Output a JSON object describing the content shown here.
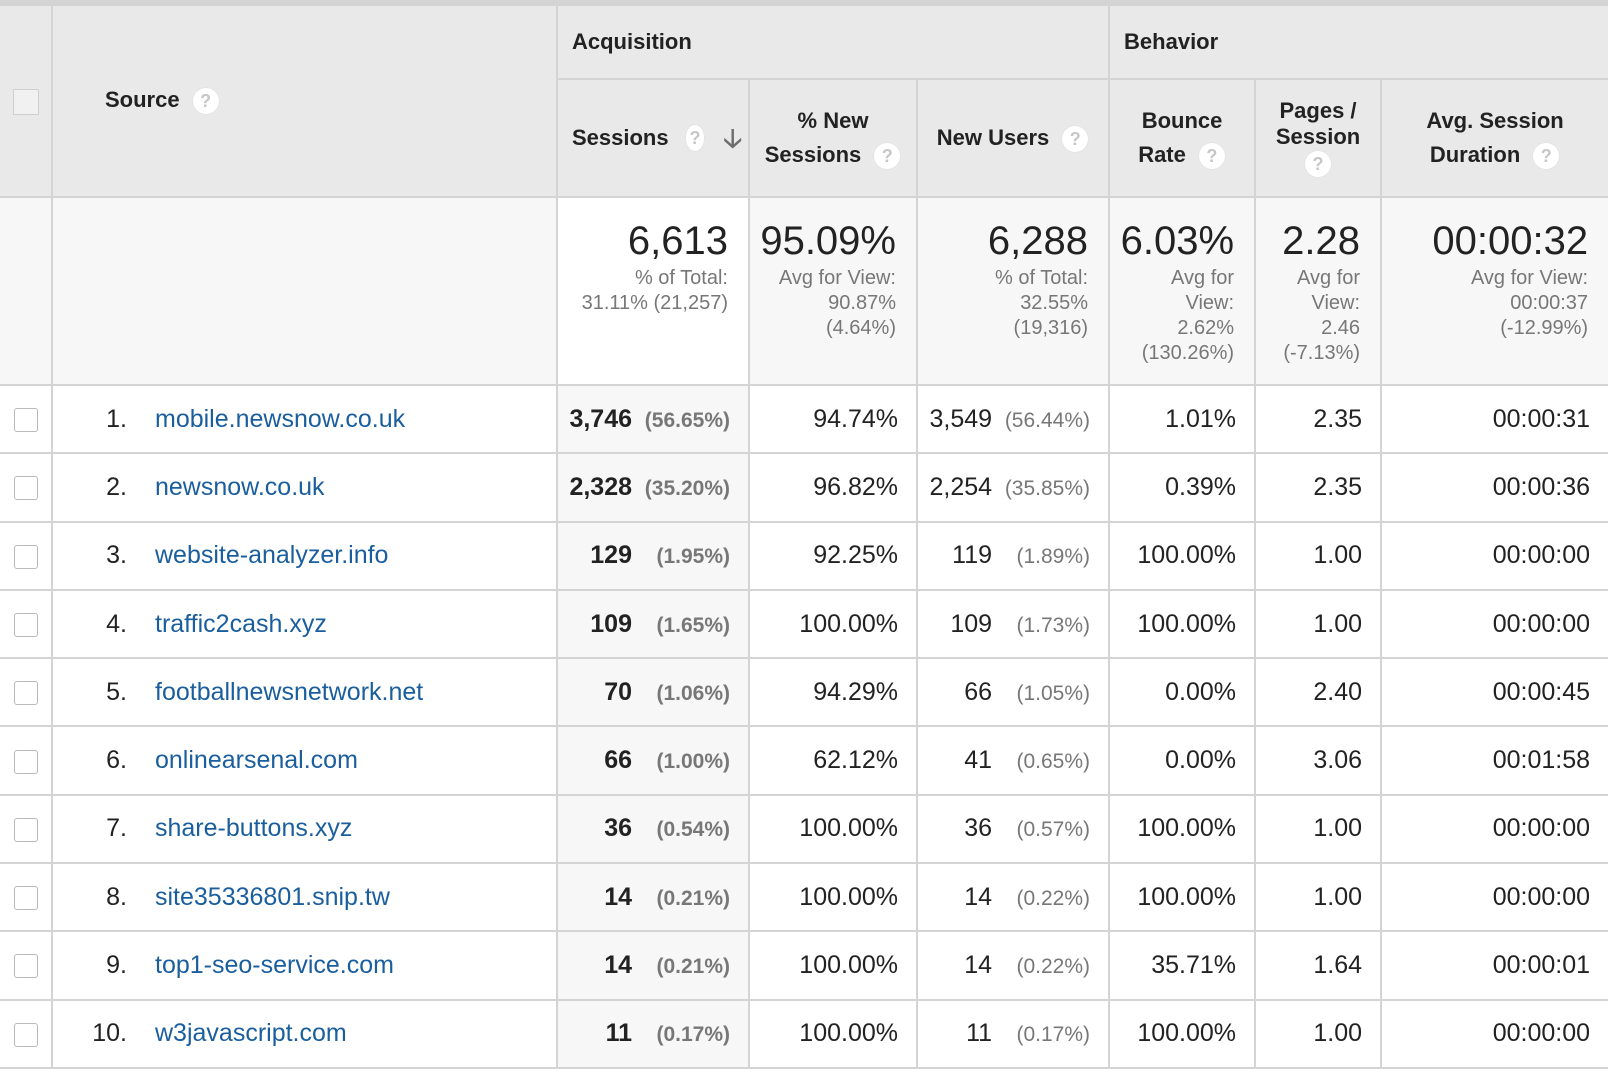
{
  "header": {
    "source_label": "Source",
    "groups": {
      "acquisition": "Acquisition",
      "behavior": "Behavior"
    },
    "sessions_label": "Sessions",
    "new_sessions_line1": "% New",
    "new_sessions_line2": "Sessions",
    "new_users_label": "New Users",
    "bounce_line1": "Bounce",
    "bounce_line2": "Rate",
    "pages_line1": "Pages /",
    "pages_line2": "Session",
    "duration_line1": "Avg. Session",
    "duration_line2": "Duration",
    "sort_icon": "arrow-down-icon",
    "help_icon": "question-mark-icon"
  },
  "totals": {
    "sessions": {
      "value": "6,613",
      "line1": "% of Total:",
      "line2": "31.11% (21,257)"
    },
    "new_sessions": {
      "value": "95.09%",
      "line1": "Avg for View:",
      "line2": "90.87%",
      "line3": "(4.64%)"
    },
    "new_users": {
      "value": "6,288",
      "line1": "% of Total:",
      "line2": "32.55%",
      "line3": "(19,316)"
    },
    "bounce_rate": {
      "value": "6.03%",
      "line1": "Avg for",
      "line2": "View:",
      "line3": "2.62%",
      "line4": "(130.26%)"
    },
    "pages_session": {
      "value": "2.28",
      "line1": "Avg for",
      "line2": "View:",
      "line3": "2.46",
      "line4": "(-7.13%)"
    },
    "duration": {
      "value": "00:00:32",
      "line1": "Avg for View:",
      "line2": "00:00:37",
      "line3": "(-12.99%)"
    }
  },
  "rows": [
    {
      "index": "1.",
      "source": "mobile.newsnow.co.uk",
      "sessions": "3,746",
      "sessions_pct": "(56.65%)",
      "new_sessions": "94.74%",
      "new_users": "3,549",
      "new_users_pct": "(56.44%)",
      "bounce_rate": "1.01%",
      "pages_session": "2.35",
      "duration": "00:00:31"
    },
    {
      "index": "2.",
      "source": "newsnow.co.uk",
      "sessions": "2,328",
      "sessions_pct": "(35.20%)",
      "new_sessions": "96.82%",
      "new_users": "2,254",
      "new_users_pct": "(35.85%)",
      "bounce_rate": "0.39%",
      "pages_session": "2.35",
      "duration": "00:00:36"
    },
    {
      "index": "3.",
      "source": "website-analyzer.info",
      "sessions": "129",
      "sessions_pct": "(1.95%)",
      "new_sessions": "92.25%",
      "new_users": "119",
      "new_users_pct": "(1.89%)",
      "bounce_rate": "100.00%",
      "pages_session": "1.00",
      "duration": "00:00:00"
    },
    {
      "index": "4.",
      "source": "traffic2cash.xyz",
      "sessions": "109",
      "sessions_pct": "(1.65%)",
      "new_sessions": "100.00%",
      "new_users": "109",
      "new_users_pct": "(1.73%)",
      "bounce_rate": "100.00%",
      "pages_session": "1.00",
      "duration": "00:00:00"
    },
    {
      "index": "5.",
      "source": "footballnewsnetwork.net",
      "sessions": "70",
      "sessions_pct": "(1.06%)",
      "new_sessions": "94.29%",
      "new_users": "66",
      "new_users_pct": "(1.05%)",
      "bounce_rate": "0.00%",
      "pages_session": "2.40",
      "duration": "00:00:45"
    },
    {
      "index": "6.",
      "source": "onlinearsenal.com",
      "sessions": "66",
      "sessions_pct": "(1.00%)",
      "new_sessions": "62.12%",
      "new_users": "41",
      "new_users_pct": "(0.65%)",
      "bounce_rate": "0.00%",
      "pages_session": "3.06",
      "duration": "00:01:58"
    },
    {
      "index": "7.",
      "source": "share-buttons.xyz",
      "sessions": "36",
      "sessions_pct": "(0.54%)",
      "new_sessions": "100.00%",
      "new_users": "36",
      "new_users_pct": "(0.57%)",
      "bounce_rate": "100.00%",
      "pages_session": "1.00",
      "duration": "00:00:00"
    },
    {
      "index": "8.",
      "source": "site35336801.snip.tw",
      "sessions": "14",
      "sessions_pct": "(0.21%)",
      "new_sessions": "100.00%",
      "new_users": "14",
      "new_users_pct": "(0.22%)",
      "bounce_rate": "100.00%",
      "pages_session": "1.00",
      "duration": "00:00:00"
    },
    {
      "index": "9.",
      "source": "top1-seo-service.com",
      "sessions": "14",
      "sessions_pct": "(0.21%)",
      "new_sessions": "100.00%",
      "new_users": "14",
      "new_users_pct": "(0.22%)",
      "bounce_rate": "35.71%",
      "pages_session": "1.64",
      "duration": "00:00:01"
    },
    {
      "index": "10.",
      "source": "w3javascript.com",
      "sessions": "11",
      "sessions_pct": "(0.17%)",
      "new_sessions": "100.00%",
      "new_users": "11",
      "new_users_pct": "(0.17%)",
      "bounce_rate": "100.00%",
      "pages_session": "1.00",
      "duration": "00:00:00"
    }
  ]
}
